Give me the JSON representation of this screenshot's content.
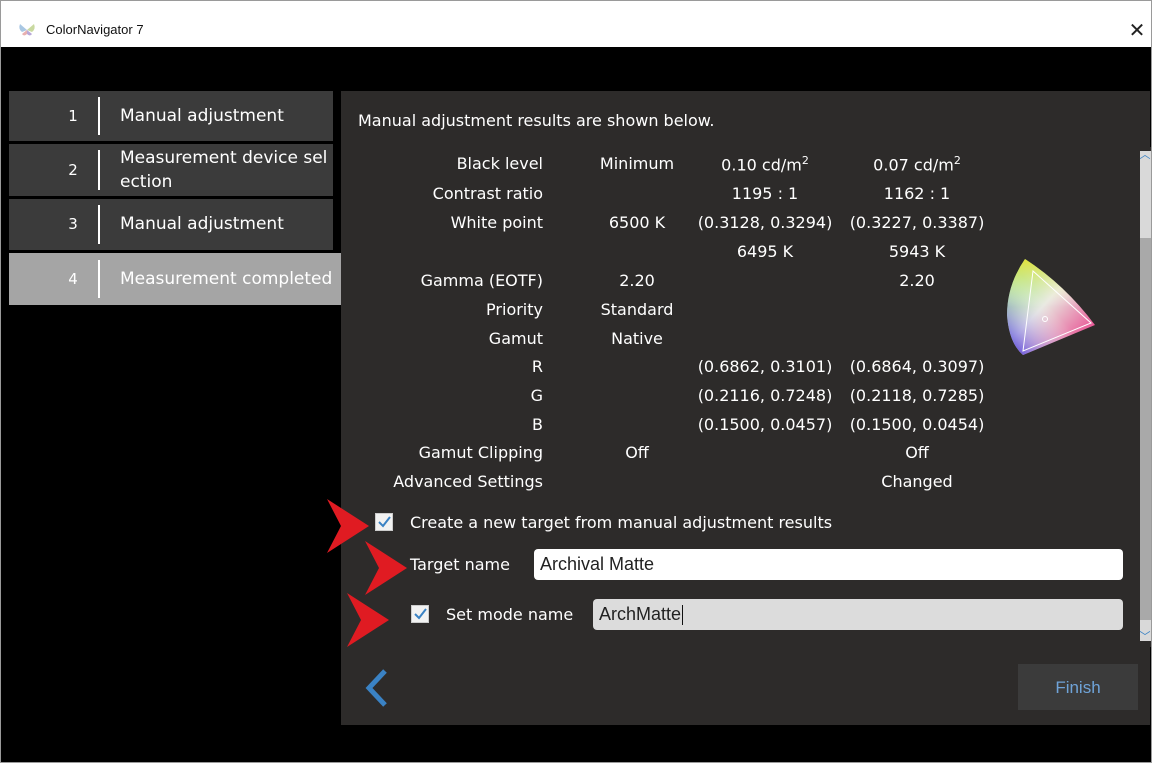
{
  "window": {
    "title": "ColorNavigator 7"
  },
  "steps": [
    {
      "num": "1",
      "label": "Manual adjustment"
    },
    {
      "num": "2",
      "label_line1": "Measurement device sel",
      "label_line2": "ection"
    },
    {
      "num": "3",
      "label": "Manual adjustment"
    },
    {
      "num": "4",
      "label": "Measurement completed"
    }
  ],
  "panel": {
    "intro": "Manual adjustment results are shown below.",
    "rows": [
      {
        "label": "Black level",
        "target": "Minimum",
        "measured1": "0.10 cd/m",
        "measured1_sup": "2",
        "measured2": "0.07 cd/m",
        "measured2_sup": "2"
      },
      {
        "label": "Contrast ratio",
        "target": "",
        "measured1": "1195 : 1",
        "measured2": "1162 : 1"
      },
      {
        "label": "White point",
        "target": "6500 K",
        "measured1": "(0.3128, 0.3294)",
        "measured2": "(0.3227, 0.3387)"
      },
      {
        "label": "",
        "target": "",
        "measured1": "6495 K",
        "measured2": "5943 K"
      },
      {
        "label": "Gamma (EOTF)",
        "target": "2.20",
        "measured1": "",
        "measured2": "2.20"
      },
      {
        "label": "Priority",
        "target": "Standard",
        "measured1": "",
        "measured2": ""
      },
      {
        "label": "Gamut",
        "target": "Native",
        "measured1": "",
        "measured2": ""
      },
      {
        "label": "R",
        "target": "",
        "measured1": "(0.6862, 0.3101)",
        "measured2": "(0.6864, 0.3097)"
      },
      {
        "label": "G",
        "target": "",
        "measured1": "(0.2116, 0.7248)",
        "measured2": "(0.2118, 0.7285)"
      },
      {
        "label": "B",
        "target": "",
        "measured1": "(0.1500, 0.0457)",
        "measured2": "(0.1500, 0.0454)"
      },
      {
        "label": "Gamut Clipping",
        "target": "Off",
        "measured1": "",
        "measured2": "Off"
      },
      {
        "label": "Advanced Settings",
        "target": "",
        "measured1": "",
        "measured2": "Changed"
      }
    ],
    "create_target": {
      "label": "Create a new target from manual adjustment results",
      "checked": true
    },
    "target_name": {
      "label": "Target name",
      "value": "Archival Matte"
    },
    "set_mode": {
      "label": "Set mode name",
      "checked": true,
      "value": "ArchMatte"
    },
    "finish_label": "Finish"
  },
  "colors": {
    "accent": "#3a82c4",
    "marker": "#e01b22",
    "panel": "#2d2b2a",
    "step": "#3b3b3b",
    "step_active": "#a5a5a5"
  }
}
